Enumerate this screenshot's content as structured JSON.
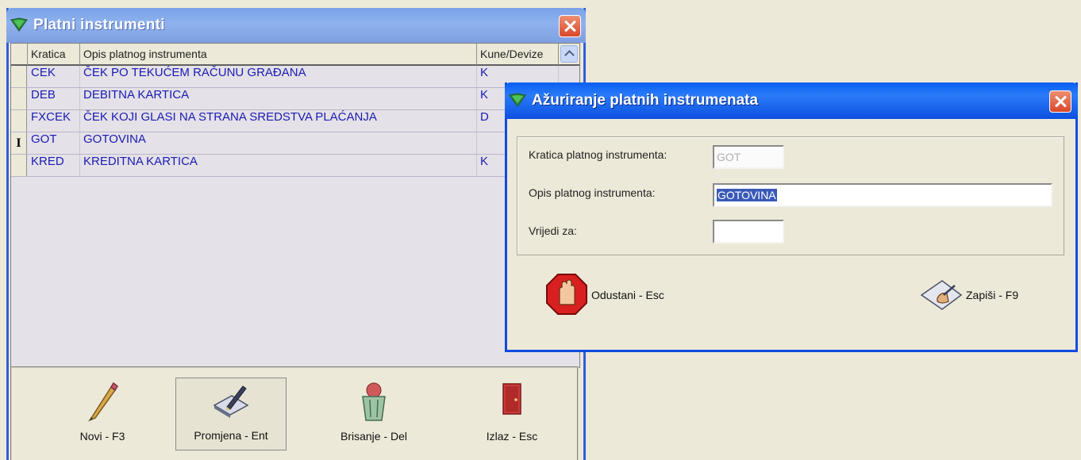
{
  "main_window": {
    "title": "Platni instrumenti",
    "columns": [
      "Kratica",
      "Opis platnog instrumenta",
      "Kune/Devize"
    ],
    "rows": [
      {
        "code": "CEK",
        "desc": "ČEK PO TEKUĆEM RAČUNU GRAĐANA",
        "currency": "K"
      },
      {
        "code": "DEB",
        "desc": "DEBITNA KARTICA",
        "currency": "K"
      },
      {
        "code": "FXCEK",
        "desc": "ČEK KOJI GLASI NA STRANA SREDSTVA PLAĆANJA",
        "currency": "D"
      },
      {
        "code": "GOT",
        "desc": "GOTOVINA",
        "currency": ""
      },
      {
        "code": "KRED",
        "desc": "KREDITNA KARTICA",
        "currency": "K"
      }
    ],
    "current_row_marker": "I",
    "toolbar": {
      "new_label": "Novi - F3",
      "edit_label": "Promjena - Ent",
      "delete_label": "Brisanje - Del",
      "exit_label": "Izlaz - Esc"
    }
  },
  "dialog": {
    "title": "Ažuriranje platnih instrumenata",
    "fields": {
      "code_label": "Kratica platnog instrumenta:",
      "code_value": "GOT",
      "desc_label": "Opis platnog instrumenta:",
      "desc_value": "GOTOVINA",
      "valid_label": "Vrijedi za:",
      "valid_value": ""
    },
    "cancel_label": "Odustani - Esc",
    "save_label": "Zapiši - F9"
  },
  "colors": {
    "main_title_bar": "#8FB2EE",
    "dialog_title_bar": "#0A5EF2",
    "grid_text": "#1B1BB2",
    "window_bg": "#ECE9D8"
  }
}
